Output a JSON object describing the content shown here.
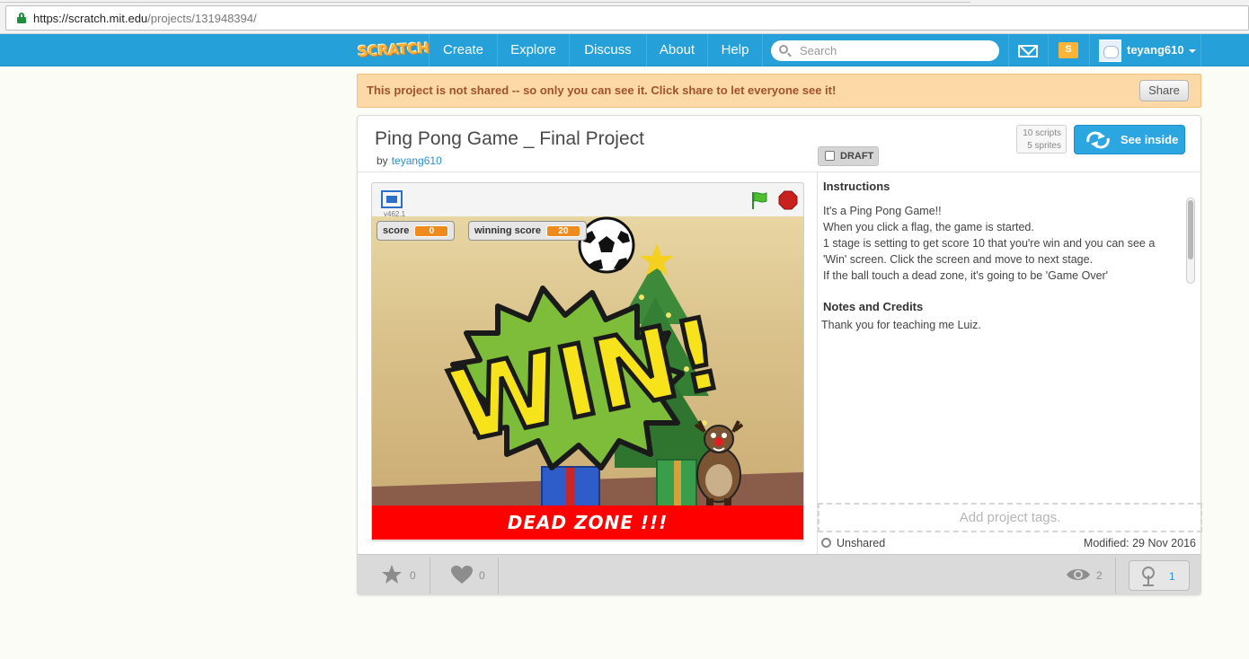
{
  "browser": {
    "url_host": "https://scratch.mit.edu",
    "url_path": "/projects/131948394/"
  },
  "nav": {
    "logo": "SCRATCH",
    "links": [
      "Create",
      "Explore",
      "Discuss",
      "About",
      "Help"
    ],
    "search_placeholder": "Search",
    "username": "teyang610",
    "icons": [
      "messages-icon",
      "my-stuff-icon",
      "avatar"
    ]
  },
  "banner": {
    "text": "This project is not shared -- so only you can see it. Click share to let everyone see it!",
    "share_label": "Share"
  },
  "project": {
    "title": "Ping Pong Game _ Final Project",
    "by_label": "by",
    "author": "teyang610",
    "draft_label": "DRAFT",
    "scripts": "10 scripts",
    "sprites": "5 sprites",
    "see_inside_label": "See inside"
  },
  "player": {
    "version": "v462.1",
    "monitors": [
      {
        "label": "score",
        "value": "0"
      },
      {
        "label": "winning score",
        "value": "20"
      }
    ],
    "win_text": "WIN!",
    "dead_zone_text": "DEAD ZONE !!!"
  },
  "info": {
    "instructions_heading": "Instructions",
    "instructions_lines": [
      "It's a Ping Pong Game!!",
      "When you click a flag, the game is started.",
      "1 stage is setting to get score 10 that you're win and you can see a",
      "'Win' screen. Click the screen and move to next stage.",
      "If the ball touch a dead zone, it's going to be 'Game Over'"
    ],
    "notes_heading": "Notes and Credits",
    "notes_text": "Thank you for teaching me Luiz.",
    "tags_placeholder": "Add project tags.",
    "sharing_status": "Unshared",
    "modified": "Modified: 29 Nov 2016"
  },
  "footer": {
    "favorites": "0",
    "loves": "0",
    "views": "2",
    "remixes": "1"
  },
  "colors": {
    "nav_blue": "#25a0d8",
    "banner_bg": "#fcd9a6",
    "banner_text": "#a0522d",
    "see_inside_blue": "#2ca6e0",
    "dead_zone_red": "#ff0000",
    "monitor_orange": "#ef8b1d"
  }
}
